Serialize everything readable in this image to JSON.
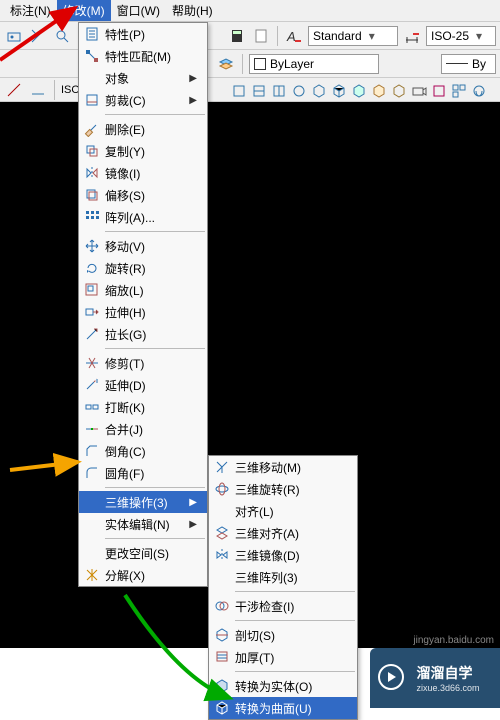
{
  "menubar": {
    "items": [
      "标注(N)",
      "修改(M)",
      "窗口(W)",
      "帮助(H)"
    ],
    "open_index": 1
  },
  "toolbar1": {
    "style_left": "Standard",
    "style_right": "ISO-25"
  },
  "toolbar2": {
    "bylayer": "ByLayer",
    "right_txt": "By"
  },
  "toolstrip": {
    "iso": "ISO"
  },
  "menu": {
    "items": [
      {
        "label": "特性(P)",
        "icon": "props"
      },
      {
        "label": "特性匹配(M)",
        "icon": "match"
      },
      {
        "label": "对象",
        "icon": "",
        "sub": true
      },
      {
        "label": "剪裁(C)",
        "icon": "clip",
        "sub": true
      },
      {
        "sep": true
      },
      {
        "label": "删除(E)",
        "icon": "erase"
      },
      {
        "label": "复制(Y)",
        "icon": "copy"
      },
      {
        "label": "镜像(I)",
        "icon": "mirror"
      },
      {
        "label": "偏移(S)",
        "icon": "offset"
      },
      {
        "label": "阵列(A)...",
        "icon": "array"
      },
      {
        "sep": true
      },
      {
        "label": "移动(V)",
        "icon": "move"
      },
      {
        "label": "旋转(R)",
        "icon": "rotate"
      },
      {
        "label": "缩放(L)",
        "icon": "scale"
      },
      {
        "label": "拉伸(H)",
        "icon": "stretch"
      },
      {
        "label": "拉长(G)",
        "icon": "lengthen"
      },
      {
        "sep": true
      },
      {
        "label": "修剪(T)",
        "icon": "trim"
      },
      {
        "label": "延伸(D)",
        "icon": "extend"
      },
      {
        "label": "打断(K)",
        "icon": "break"
      },
      {
        "label": "合并(J)",
        "icon": "join"
      },
      {
        "label": "倒角(C)",
        "icon": "chamfer"
      },
      {
        "label": "圆角(F)",
        "icon": "fillet"
      },
      {
        "sep": true
      },
      {
        "label": "三维操作(3)",
        "icon": "",
        "sub": true,
        "hl": true
      },
      {
        "label": "实体编辑(N)",
        "icon": "",
        "sub": true
      },
      {
        "sep": true
      },
      {
        "label": "更改空间(S)",
        "icon": ""
      },
      {
        "label": "分解(X)",
        "icon": "explode"
      }
    ]
  },
  "submenu": {
    "items": [
      {
        "label": "三维移动(M)",
        "icon": "3dmove"
      },
      {
        "label": "三维旋转(R)",
        "icon": "3drot"
      },
      {
        "label": "对齐(L)",
        "icon": ""
      },
      {
        "label": "三维对齐(A)",
        "icon": "3dalign"
      },
      {
        "label": "三维镜像(D)",
        "icon": "3dmir"
      },
      {
        "label": "三维阵列(3)",
        "icon": ""
      },
      {
        "sep": true
      },
      {
        "label": "干涉检查(I)",
        "icon": "interf"
      },
      {
        "sep": true
      },
      {
        "label": "剖切(S)",
        "icon": "slice"
      },
      {
        "label": "加厚(T)",
        "icon": "thick"
      },
      {
        "sep": true
      },
      {
        "label": "转换为实体(O)",
        "icon": "tosolid"
      },
      {
        "label": "转换为曲面(U)",
        "icon": "tosurf",
        "hl": true
      }
    ]
  },
  "watermark": {
    "top": "jingyan.baidu.com",
    "big": "溜溜自学",
    "small": "zixue.3d66.com"
  }
}
